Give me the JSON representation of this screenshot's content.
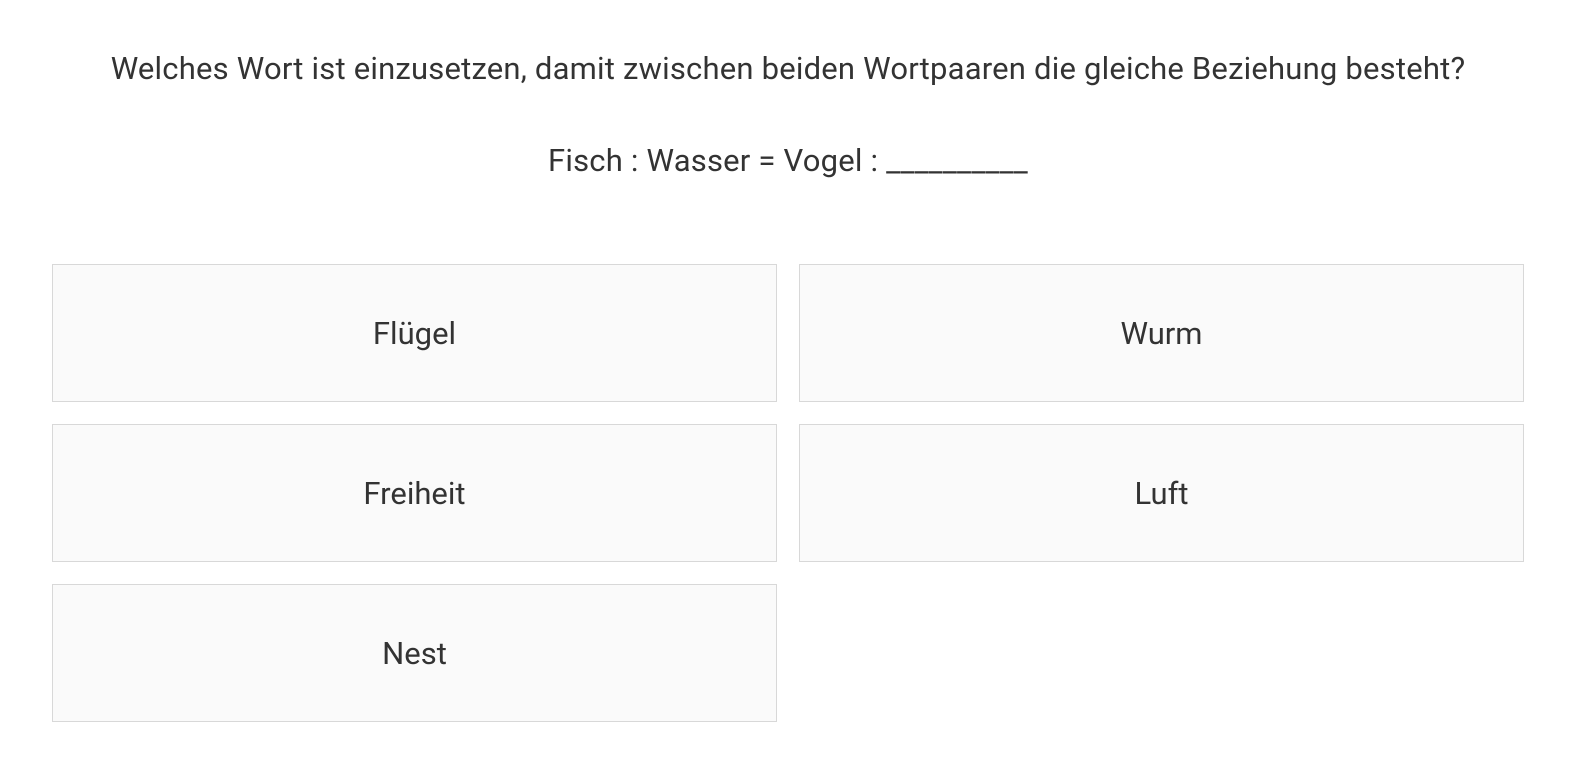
{
  "question": {
    "prompt": "Welches Wort ist einzusetzen, damit zwischen beiden Wortpaaren die gleiche Beziehung besteht?",
    "analogy": "Fisch : Wasser = Vogel : __________"
  },
  "options": [
    {
      "label": "Flügel"
    },
    {
      "label": "Wurm"
    },
    {
      "label": "Freiheit"
    },
    {
      "label": "Luft"
    },
    {
      "label": "Nest"
    }
  ]
}
